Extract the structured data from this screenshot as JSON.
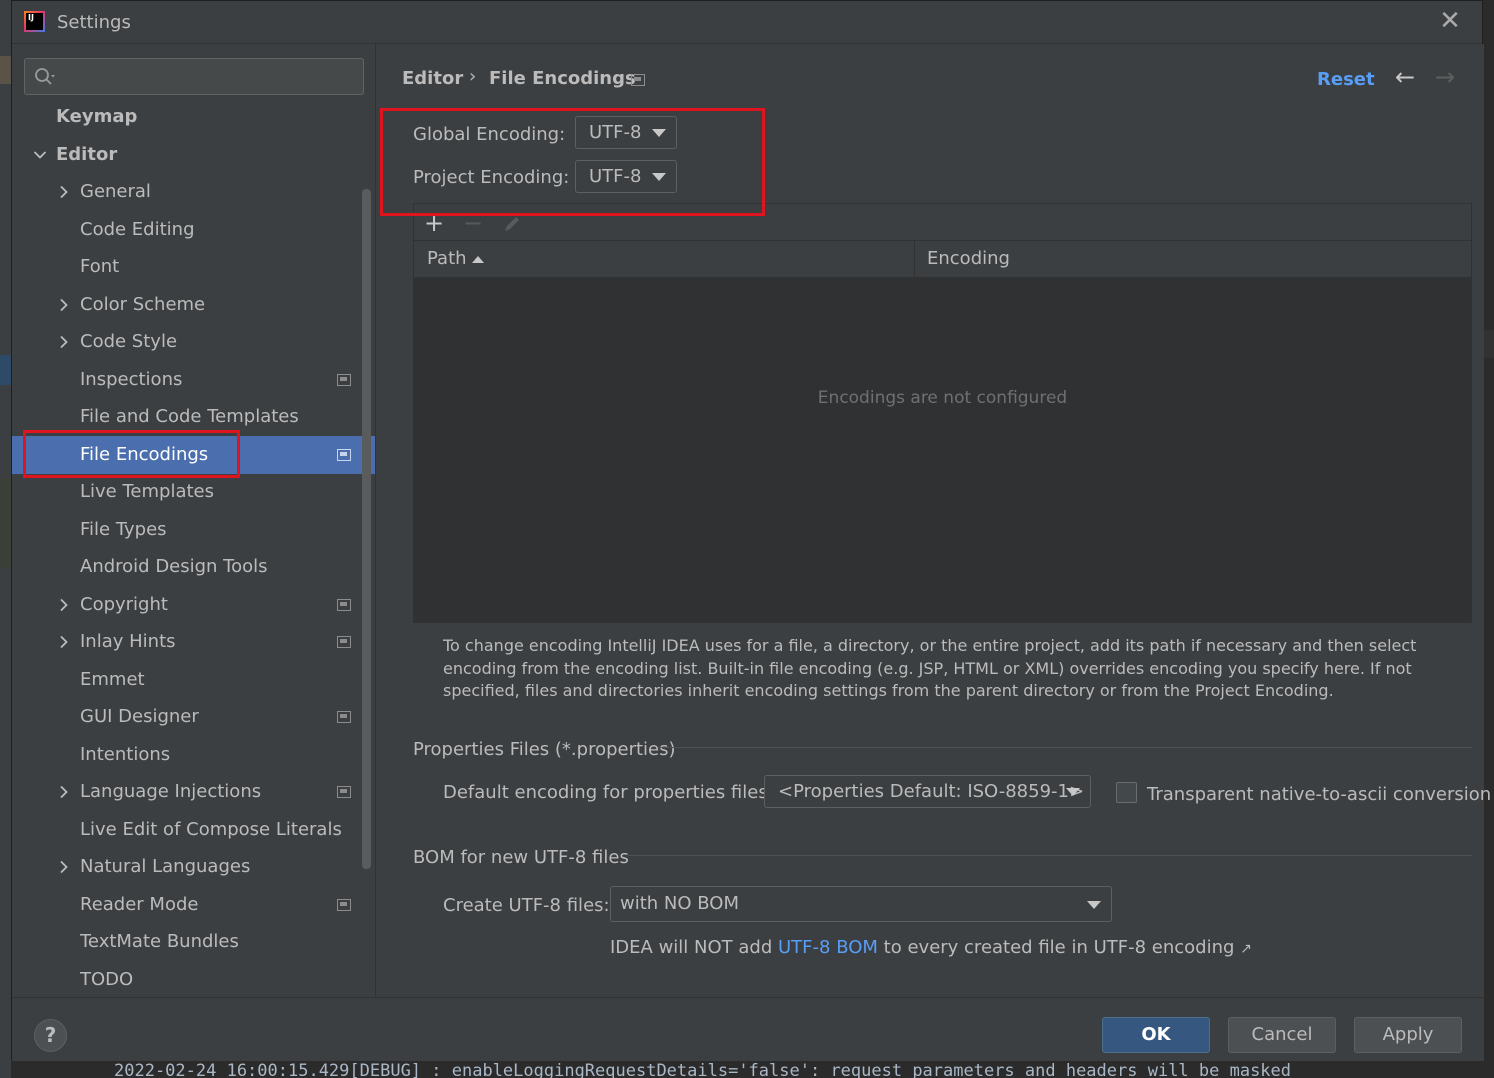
{
  "window": {
    "title": "Settings"
  },
  "sidebar": {
    "search_placeholder": "",
    "items": [
      {
        "label": "Keymap"
      },
      {
        "label": "Editor"
      },
      {
        "label": "General"
      },
      {
        "label": "Code Editing"
      },
      {
        "label": "Font"
      },
      {
        "label": "Color Scheme"
      },
      {
        "label": "Code Style"
      },
      {
        "label": "Inspections"
      },
      {
        "label": "File and Code Templates"
      },
      {
        "label": "File Encodings"
      },
      {
        "label": "Live Templates"
      },
      {
        "label": "File Types"
      },
      {
        "label": "Android Design Tools"
      },
      {
        "label": "Copyright"
      },
      {
        "label": "Inlay Hints"
      },
      {
        "label": "Emmet"
      },
      {
        "label": "GUI Designer"
      },
      {
        "label": "Intentions"
      },
      {
        "label": "Language Injections"
      },
      {
        "label": "Live Edit of Compose Literals"
      },
      {
        "label": "Natural Languages"
      },
      {
        "label": "Reader Mode"
      },
      {
        "label": "TextMate Bundles"
      },
      {
        "label": "TODO"
      }
    ],
    "selected": "File Encodings"
  },
  "breadcrumb": {
    "parent": "Editor",
    "current": "File Encodings"
  },
  "header": {
    "reset_label": "Reset"
  },
  "encodings": {
    "global_label": "Global Encoding:",
    "global_value": "UTF-8",
    "project_label": "Project Encoding:",
    "project_value": "UTF-8"
  },
  "table": {
    "columns": [
      "Path",
      "Encoding"
    ],
    "sorted_by": "Path",
    "empty_text": "Encodings are not configured"
  },
  "description": "To change encoding IntelliJ IDEA uses for a file, a directory, or the entire project, add its path if necessary and then select encoding from the encoding list. Built-in file encoding (e.g. JSP, HTML or XML) overrides encoding you specify here. If not specified, files and directories inherit encoding settings from the parent directory or from the Project Encoding.",
  "properties": {
    "section_title": "Properties Files (*.properties)",
    "default_label": "Default encoding for properties files:",
    "default_value": "<Properties Default: ISO-8859-1>",
    "transparent_label": "Transparent native-to-ascii conversion",
    "transparent_checked": false
  },
  "bom": {
    "section_title": "BOM for new UTF-8 files",
    "create_label": "Create UTF-8 files:",
    "create_value": "with NO BOM",
    "hint_prefix": "IDEA will NOT add",
    "hint_link": "UTF-8 BOM",
    "hint_suffix": "to every created file in UTF-8 encoding"
  },
  "footer": {
    "help_label": "?",
    "ok_label": "OK",
    "cancel_label": "Cancel",
    "apply_label": "Apply"
  },
  "background": {
    "console_line": "2022-02-24 16:00:15.429[DEBUG] : enableLoggingRequestDetails='false': request parameters and headers will be masked"
  },
  "colors": {
    "accent": "#4b6eaf",
    "link": "#589df6",
    "highlight_box": "#e0141e",
    "ok_button": "#365880"
  }
}
